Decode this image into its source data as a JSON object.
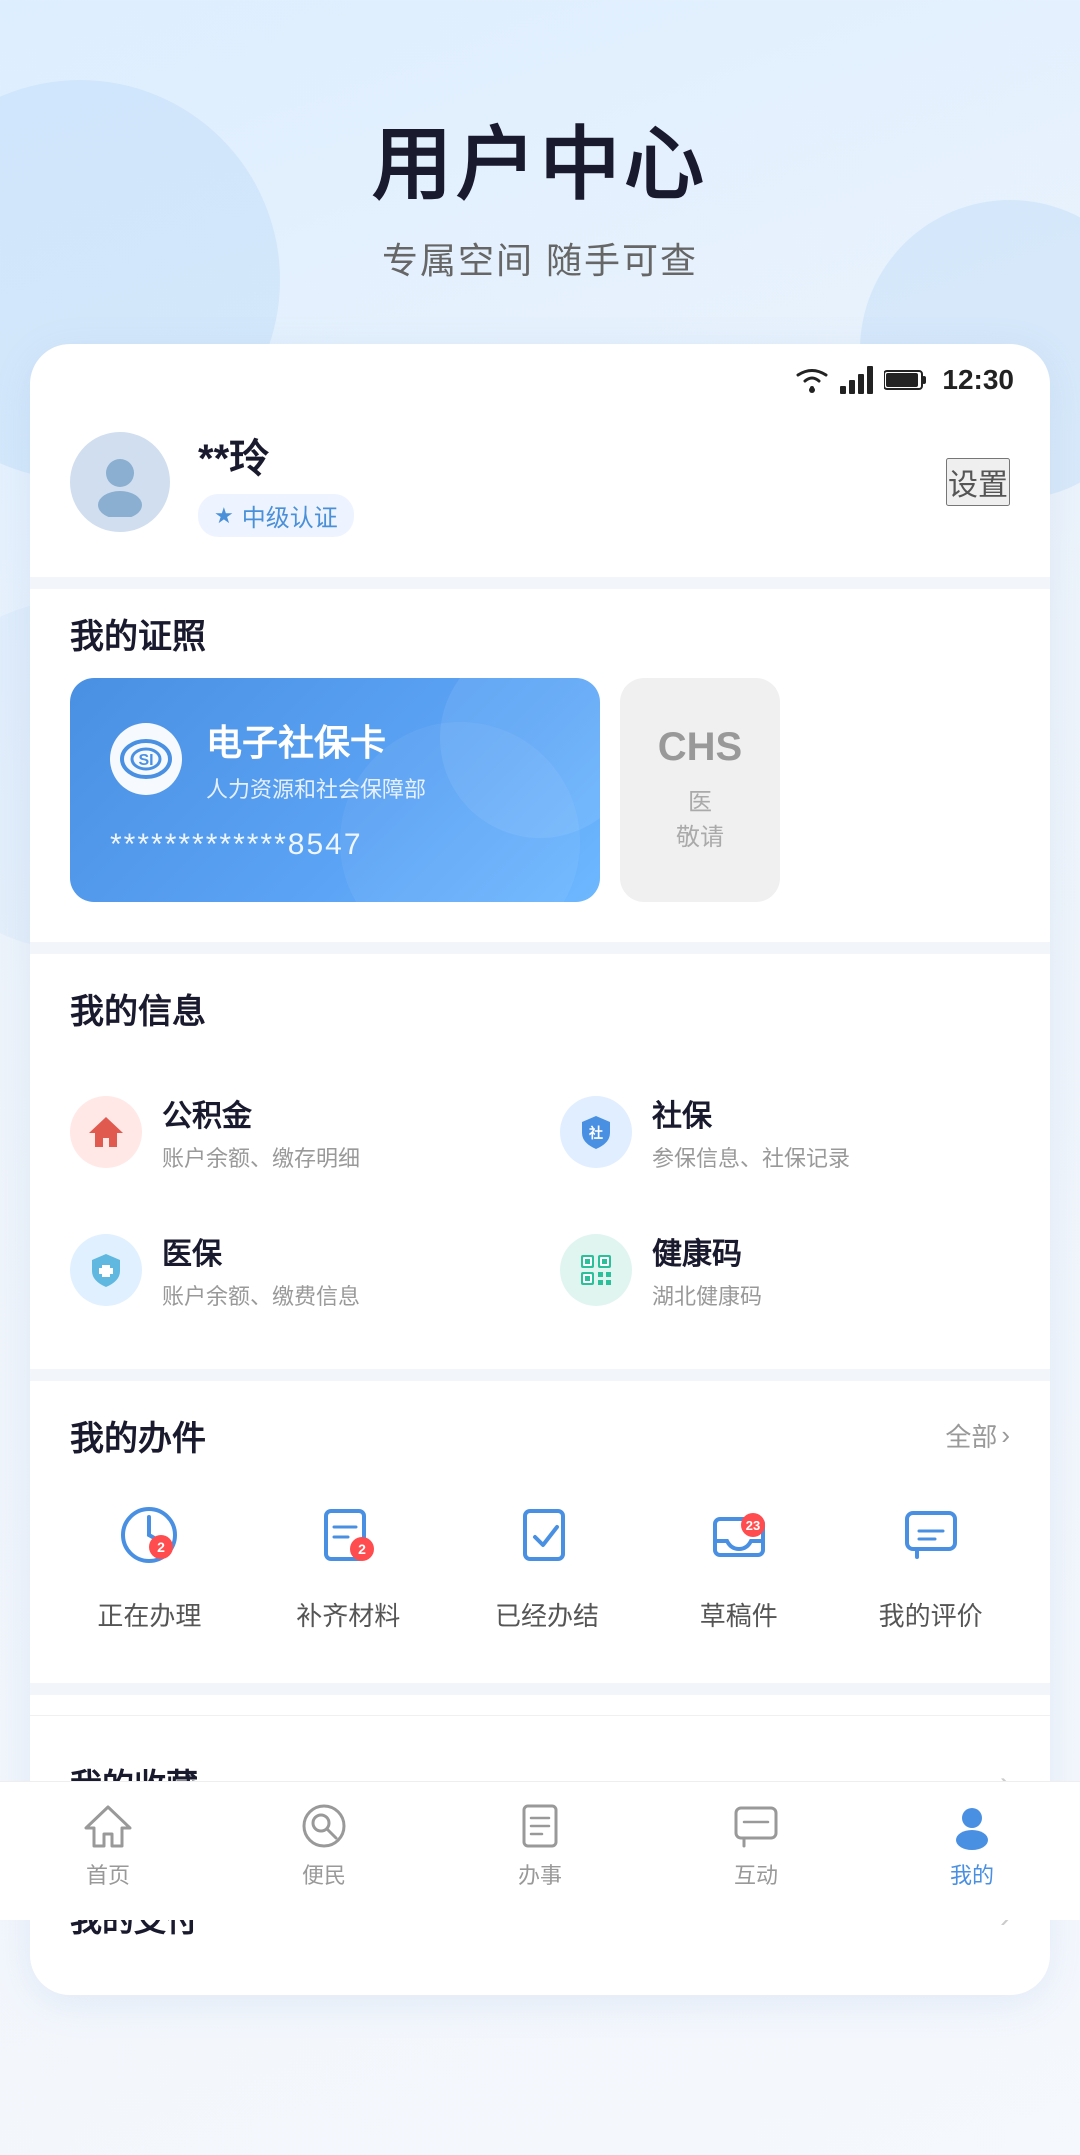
{
  "page": {
    "title": "用户中心",
    "subtitle": "专属空间 随手可查"
  },
  "statusBar": {
    "time": "12:30"
  },
  "user": {
    "name": "**玲",
    "certLevel": "中级认证",
    "settingsLabel": "设置"
  },
  "certificates": {
    "sectionTitle": "我的证照",
    "cards": [
      {
        "type": "social_security",
        "name": "电子社保卡",
        "issuer": "人力资源和社会保障部",
        "number": "*************8547",
        "logoText": "si"
      },
      {
        "type": "medical",
        "logoText": "CHS",
        "text": "医\n保",
        "subtext": "敬请"
      }
    ]
  },
  "myInfo": {
    "sectionTitle": "我的信息",
    "items": [
      {
        "name": "公积金",
        "desc": "账户余额、缴存明细",
        "iconColor": "red",
        "iconSymbol": "🏠"
      },
      {
        "name": "社保",
        "desc": "参保信息、社保记录",
        "iconColor": "blue",
        "iconSymbol": "🛡"
      },
      {
        "name": "医保",
        "desc": "账户余额、缴费信息",
        "iconColor": "lightblue",
        "iconSymbol": "🏥"
      },
      {
        "name": "健康码",
        "desc": "湖北健康码",
        "iconColor": "teal",
        "iconSymbol": "⬛"
      }
    ]
  },
  "myAffairs": {
    "sectionTitle": "我的办件",
    "viewAllLabel": "全部",
    "items": [
      {
        "label": "正在办理",
        "badge": 2,
        "iconType": "clock"
      },
      {
        "label": "补齐材料",
        "badge": 2,
        "iconType": "document-check"
      },
      {
        "label": "已经办结",
        "badge": null,
        "iconType": "document-done"
      },
      {
        "label": "草稿件",
        "badge": 23,
        "iconType": "inbox"
      },
      {
        "label": "我的评价",
        "badge": null,
        "iconType": "comment"
      }
    ]
  },
  "bottomItems": [
    {
      "label": "我的收藏"
    },
    {
      "label": "我的支付"
    }
  ],
  "bottomNav": {
    "items": [
      {
        "label": "首页",
        "iconType": "home",
        "active": false
      },
      {
        "label": "便民",
        "iconType": "search-circle",
        "active": false
      },
      {
        "label": "办事",
        "iconType": "document",
        "active": false
      },
      {
        "label": "互动",
        "iconType": "comment-box",
        "active": false
      },
      {
        "label": "我的",
        "iconType": "person",
        "active": true
      }
    ]
  }
}
